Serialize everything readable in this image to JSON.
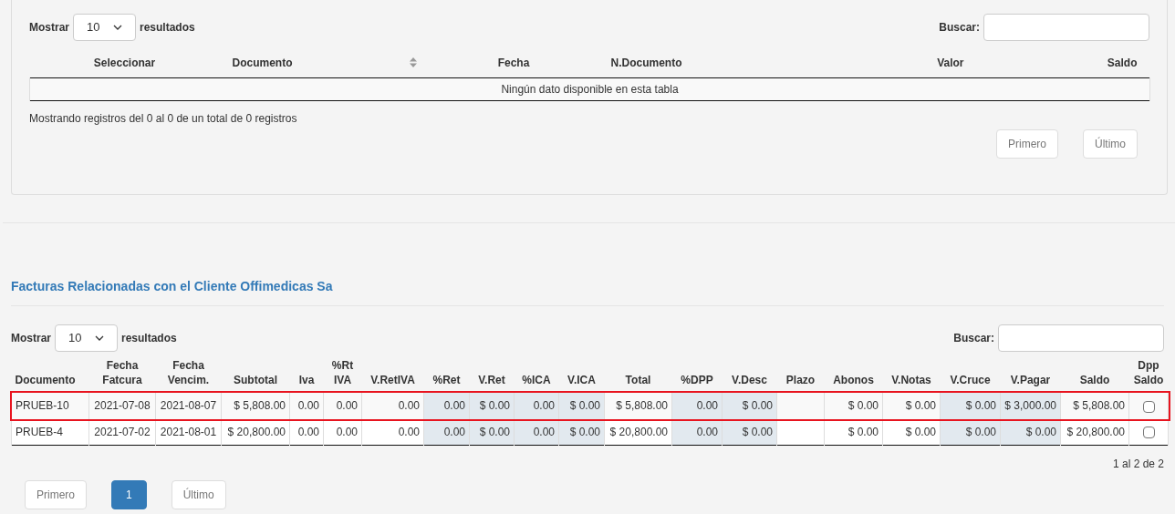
{
  "top_panel": {
    "length_label_before": "Mostrar",
    "length_value": "10",
    "length_label_after": "resultados",
    "search_label": "Buscar:",
    "table": {
      "columns": [
        {
          "label": "Seleccionar",
          "sortable": false
        },
        {
          "label": "Documento",
          "sortable": true
        },
        {
          "label": "Fecha",
          "sortable": false
        },
        {
          "label": "N.Documento",
          "sortable": false
        },
        {
          "label": "Valor",
          "sortable": false
        },
        {
          "label": "Saldo",
          "sortable": false
        }
      ],
      "empty_message": "Ningún dato disponible en esta tabla"
    },
    "info": "Mostrando registros del 0 al 0 de un total de 0 registros",
    "pagination": [
      {
        "label": "Primero",
        "kind": "button",
        "selected": false
      },
      {
        "label": "Último",
        "kind": "button",
        "selected": false
      }
    ]
  },
  "invoices": {
    "title": "Facturas Relacionadas con el Cliente Offimedicas Sa",
    "length_label_before": "Mostrar",
    "length_value": "10",
    "length_label_after": "resultados",
    "search_label": "Buscar:",
    "table": {
      "columns": [
        {
          "label": "Documento",
          "shaded": false
        },
        {
          "label": "Fecha\nFatcura",
          "shaded": false
        },
        {
          "label": "Fecha\nVencim.",
          "shaded": false
        },
        {
          "label": "Subtotal",
          "shaded": false
        },
        {
          "label": "Iva",
          "shaded": false
        },
        {
          "label": "%Rt\nIVA",
          "shaded": false
        },
        {
          "label": "V.RetIVA",
          "shaded": false
        },
        {
          "label": "%Ret",
          "shaded": true
        },
        {
          "label": "V.Ret",
          "shaded": true
        },
        {
          "label": "%ICA",
          "shaded": true
        },
        {
          "label": "V.ICA",
          "shaded": true
        },
        {
          "label": "Total",
          "shaded": false
        },
        {
          "label": "%DPP",
          "shaded": true
        },
        {
          "label": "V.Desc",
          "shaded": true
        },
        {
          "label": "Plazo",
          "shaded": false
        },
        {
          "label": "Abonos",
          "shaded": false
        },
        {
          "label": "V.Notas",
          "shaded": false
        },
        {
          "label": "V.Cruce",
          "shaded": true
        },
        {
          "label": "V.Pagar",
          "shaded": true
        },
        {
          "label": "Saldo",
          "shaded": false
        },
        {
          "label": "Dpp\nSaldo",
          "shaded": false
        }
      ],
      "rows": [
        {
          "highlighted": true,
          "checked": false,
          "cells": [
            "PRUEB-10",
            "2021-07-08",
            "2021-08-07",
            "$ 5,808.00",
            "0.00",
            "0.00",
            "0.00",
            "0.00",
            "$ 0.00",
            "0.00",
            "$ 0.00",
            "$ 5,808.00",
            "0.00",
            "$ 0.00",
            "",
            "$ 0.00",
            "$ 0.00",
            "$ 0.00",
            "$ 3,000.00",
            "$ 5,808.00"
          ]
        },
        {
          "highlighted": false,
          "checked": false,
          "cells": [
            "PRUEB-4",
            "2021-07-02",
            "2021-08-01",
            "$ 20,800.00",
            "0.00",
            "0.00",
            "0.00",
            "0.00",
            "$ 0.00",
            "0.00",
            "$ 0.00",
            "$ 20,800.00",
            "0.00",
            "$ 0.00",
            "",
            "$ 0.00",
            "$ 0.00",
            "$ 0.00",
            "$ 0.00",
            "$ 20,800.00"
          ]
        }
      ]
    },
    "info": "1 al 2 de 2",
    "pagination": [
      {
        "label": "Primero",
        "kind": "button",
        "selected": false
      },
      {
        "label": "1",
        "kind": "page",
        "selected": true
      },
      {
        "label": "Último",
        "kind": "button",
        "selected": false
      }
    ]
  }
}
